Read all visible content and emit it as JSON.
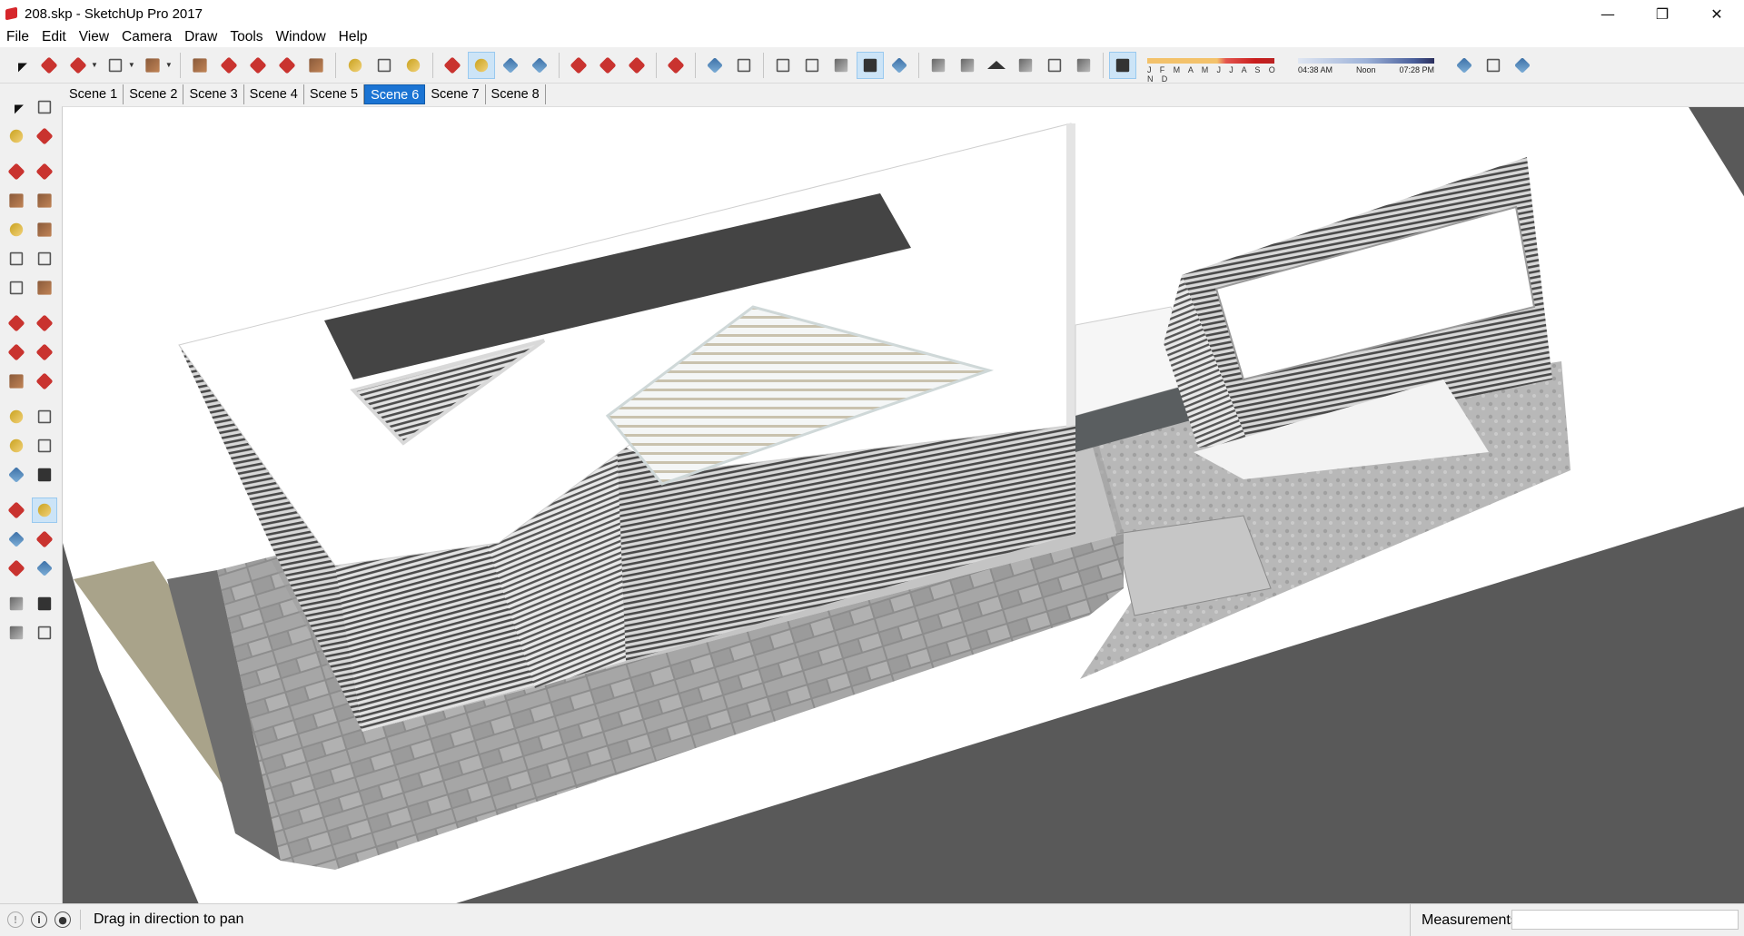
{
  "window": {
    "title": "208.skp - SketchUp Pro 2017",
    "minimize_glyph": "—",
    "maximize_glyph": "❐",
    "close_glyph": "✕"
  },
  "menu": [
    "File",
    "Edit",
    "View",
    "Camera",
    "Draw",
    "Tools",
    "Window",
    "Help"
  ],
  "toolbar": {
    "active_tool": "pan",
    "shadow": {
      "months": "J F M A M J J A S O N D",
      "time_start": "04:38 AM",
      "time_mid": "Noon",
      "time_end": "07:28 PM"
    }
  },
  "scenes": {
    "tabs": [
      "Scene 1",
      "Scene 2",
      "Scene 3",
      "Scene 4",
      "Scene 5",
      "Scene 6",
      "Scene 7",
      "Scene 8"
    ],
    "active": "Scene 6"
  },
  "status": {
    "message": "Drag in direction to pan",
    "measurements_label": "Measurements",
    "measurements_value": ""
  },
  "colors": {
    "accent": "#1b74d3",
    "road": "#595959",
    "paving": "#a9a9a9",
    "facade_stripe": "#5c5c5c",
    "roof": "#ffffff"
  }
}
